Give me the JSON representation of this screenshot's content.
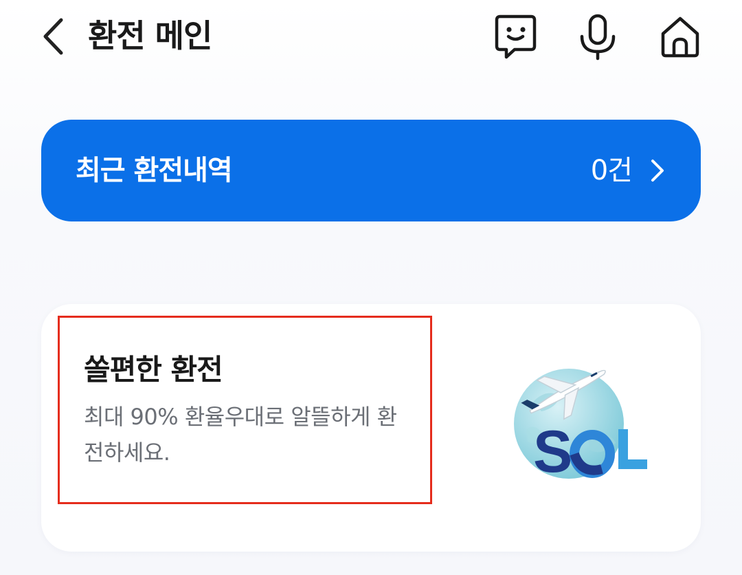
{
  "header": {
    "title": "환전 메인",
    "icons": {
      "back": "chevron-left-icon",
      "chat": "chatbot-icon",
      "mic": "microphone-icon",
      "home": "home-icon"
    }
  },
  "recent": {
    "label": "최근 환전내역",
    "count": "0건",
    "chevron": "chevron-right-icon",
    "background": "#0b70e8"
  },
  "promo": {
    "title": "쏠편한 환전",
    "description": "최대 90% 환율우대로 알뜰하게 환전하세요.",
    "illustration": "globe-airplane-illustration",
    "logo_text": "SOL",
    "highlight_color": "#e52c1c"
  }
}
